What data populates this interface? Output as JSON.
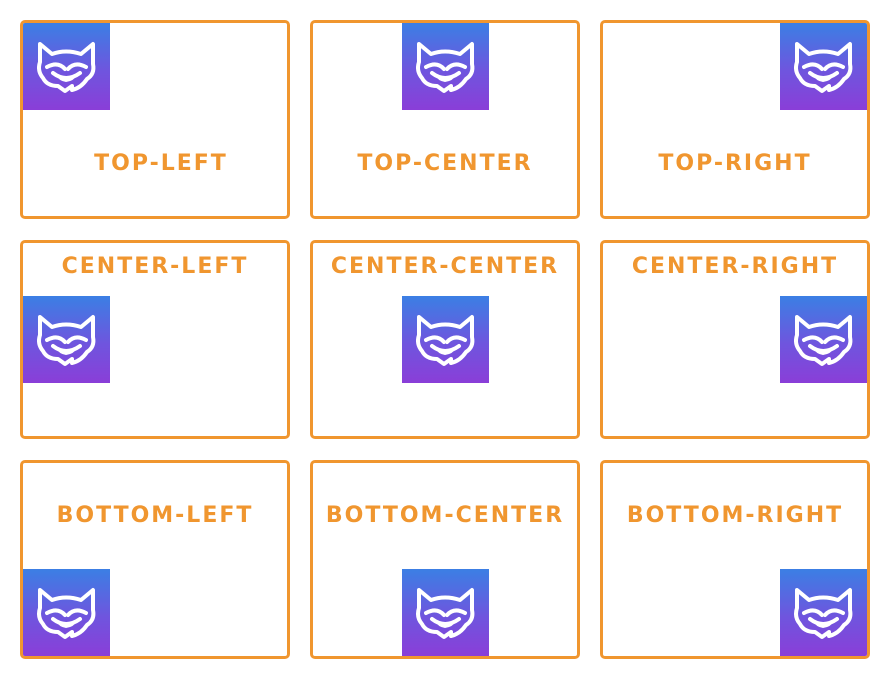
{
  "colors": {
    "accent": "#f0962f",
    "logo_gradient_top": "#3b7fe4",
    "logo_gradient_bottom": "#8a3ed8"
  },
  "logo_icon": "monster-face-icon",
  "cards": [
    {
      "label": "TOP-LEFT"
    },
    {
      "label": "TOP-CENTER"
    },
    {
      "label": "TOP-RIGHT"
    },
    {
      "label": "CENTER-LEFT"
    },
    {
      "label": "CENTER-CENTER"
    },
    {
      "label": "CENTER-RIGHT"
    },
    {
      "label": "BOTTOM-LEFT"
    },
    {
      "label": "BOTTOM-CENTER"
    },
    {
      "label": "BOTTOM-RIGHT"
    }
  ]
}
